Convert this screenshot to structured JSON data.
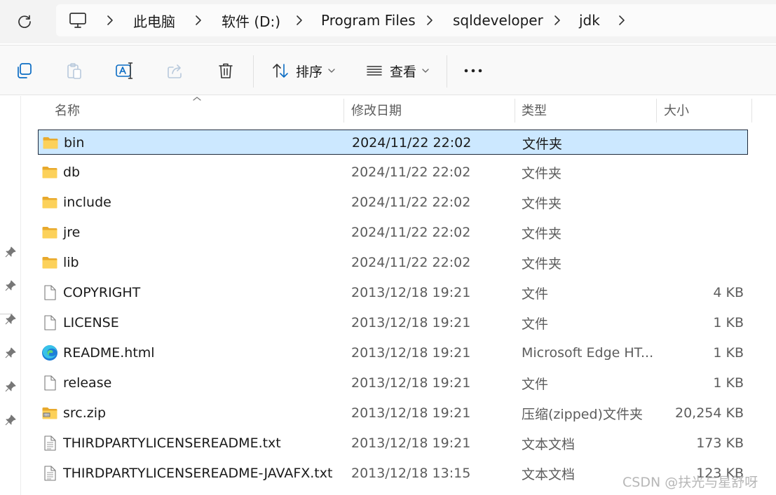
{
  "addressbar": {
    "crumbs": [
      "此电脑",
      "软件 (D:)",
      "Program Files",
      "sqldeveloper",
      "jdk"
    ]
  },
  "commandbar": {
    "sort_label": "排序",
    "view_label": "查看"
  },
  "columns": {
    "name": "名称",
    "modified": "修改日期",
    "type": "类型",
    "size": "大小"
  },
  "files": [
    {
      "icon": "folder-icon",
      "name": "bin",
      "modified": "2024/11/22 22:02",
      "type": "文件夹",
      "size": ""
    },
    {
      "icon": "folder-icon",
      "name": "db",
      "modified": "2024/11/22 22:02",
      "type": "文件夹",
      "size": ""
    },
    {
      "icon": "folder-icon",
      "name": "include",
      "modified": "2024/11/22 22:02",
      "type": "文件夹",
      "size": ""
    },
    {
      "icon": "folder-icon",
      "name": "jre",
      "modified": "2024/11/22 22:02",
      "type": "文件夹",
      "size": ""
    },
    {
      "icon": "folder-icon",
      "name": "lib",
      "modified": "2024/11/22 22:02",
      "type": "文件夹",
      "size": ""
    },
    {
      "icon": "file-icon",
      "name": "COPYRIGHT",
      "modified": "2013/12/18 19:21",
      "type": "文件",
      "size": "4 KB"
    },
    {
      "icon": "file-icon",
      "name": "LICENSE",
      "modified": "2013/12/18 19:21",
      "type": "文件",
      "size": "1 KB"
    },
    {
      "icon": "edge-icon",
      "name": "README.html",
      "modified": "2013/12/18 19:21",
      "type": "Microsoft Edge HT...",
      "size": "1 KB"
    },
    {
      "icon": "file-icon",
      "name": "release",
      "modified": "2013/12/18 19:21",
      "type": "文件",
      "size": "1 KB"
    },
    {
      "icon": "zip-folder-icon",
      "name": "src.zip",
      "modified": "2013/12/18 19:21",
      "type": "压缩(zipped)文件夹",
      "size": "20,254 KB"
    },
    {
      "icon": "text-file-icon",
      "name": "THIRDPARTYLICENSEREADME.txt",
      "modified": "2013/12/18 19:21",
      "type": "文本文档",
      "size": "173 KB"
    },
    {
      "icon": "text-file-icon",
      "name": "THIRDPARTYLICENSEREADME-JAVAFX.txt",
      "modified": "2013/12/18 13:15",
      "type": "文本文档",
      "size": "123 KB"
    }
  ],
  "selected_item": "bin",
  "watermark": "CSDN @扶光与星舒呀",
  "colors": {
    "selection_bg": "#cce8ff",
    "selection_border": "#1e2a3c",
    "folder_yellow": "#f6c644"
  }
}
